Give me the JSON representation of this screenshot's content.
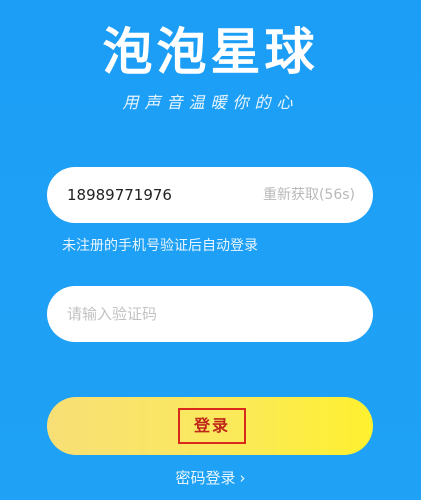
{
  "app": {
    "title": "泡泡星球",
    "subtitle": "用声音温暖你的心"
  },
  "phone": {
    "value": "18989771976",
    "resend_label": "重新获取(56s)"
  },
  "hint": "未注册的手机号验证后自动登录",
  "code": {
    "placeholder": "请输入验证码"
  },
  "login": {
    "label": "登录"
  },
  "password_login": {
    "label": "密码登录",
    "chevron": "›"
  },
  "colors": {
    "background": "#1ea0f5",
    "button_start": "#f8df76",
    "button_end": "#fff02f",
    "highlight_box": "#d9281c"
  }
}
